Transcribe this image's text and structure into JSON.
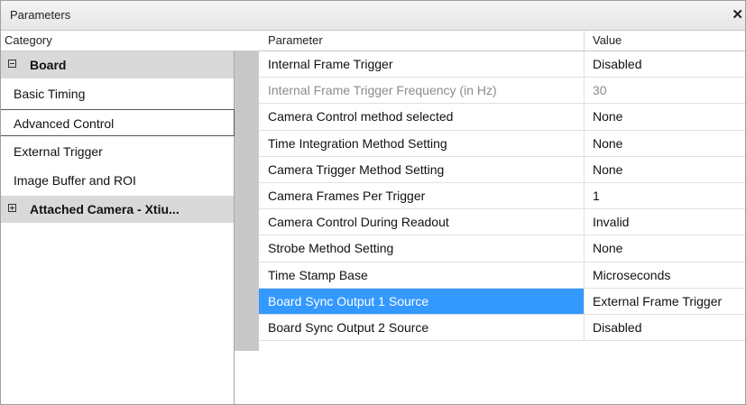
{
  "window": {
    "title": "Parameters",
    "close_glyph": "✕"
  },
  "headers": {
    "category": "Category",
    "parameter": "Parameter",
    "value": "Value"
  },
  "categories": [
    {
      "label": "Board",
      "expander": "minus"
    },
    {
      "label": "Basic Timing"
    },
    {
      "label": "Advanced Control",
      "selected": true
    },
    {
      "label": "External Trigger"
    },
    {
      "label": "Image Buffer and ROI"
    },
    {
      "label": "Attached Camera - Xtiu...",
      "expander": "plus"
    }
  ],
  "parameters": [
    {
      "name": "Internal Frame Trigger",
      "value": "Disabled"
    },
    {
      "name": "Internal Frame Trigger Frequency (in Hz)",
      "value": "30",
      "disabled": true
    },
    {
      "name": "Camera Control method selected",
      "value": "None"
    },
    {
      "name": "Time Integration Method Setting",
      "value": "None"
    },
    {
      "name": "Camera Trigger Method Setting",
      "value": "None"
    },
    {
      "name": "Camera Frames Per Trigger",
      "value": "1"
    },
    {
      "name": "Camera Control During Readout",
      "value": "Invalid"
    },
    {
      "name": "Strobe Method Setting",
      "value": "None"
    },
    {
      "name": "Time Stamp Base",
      "value": "Microseconds"
    },
    {
      "name": "Board Sync Output 1 Source",
      "value": "External Frame Trigger",
      "selected": true
    },
    {
      "name": "Board Sync Output 2 Source",
      "value": "Disabled"
    }
  ],
  "colors": {
    "selection": "#3399ff",
    "group_bg": "#d9d9d9",
    "gutter": "#c8c8c8"
  }
}
